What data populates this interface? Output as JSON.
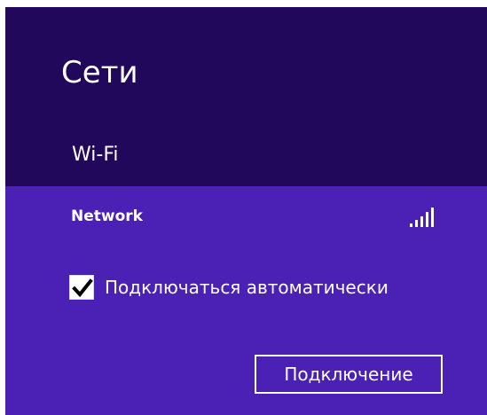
{
  "panel": {
    "title": "Сети",
    "section_label": "Wi-Fi"
  },
  "network": {
    "name": "Network",
    "signal_icon": "wifi-signal-bars-icon",
    "signal_strength": 5
  },
  "auto_connect": {
    "label": "Подключаться автоматически",
    "checked": true
  },
  "connect_button": {
    "label": "Подключение"
  },
  "colors": {
    "header_background": "#21085a",
    "body_background": "#4a21b4",
    "text": "#ffffff"
  }
}
